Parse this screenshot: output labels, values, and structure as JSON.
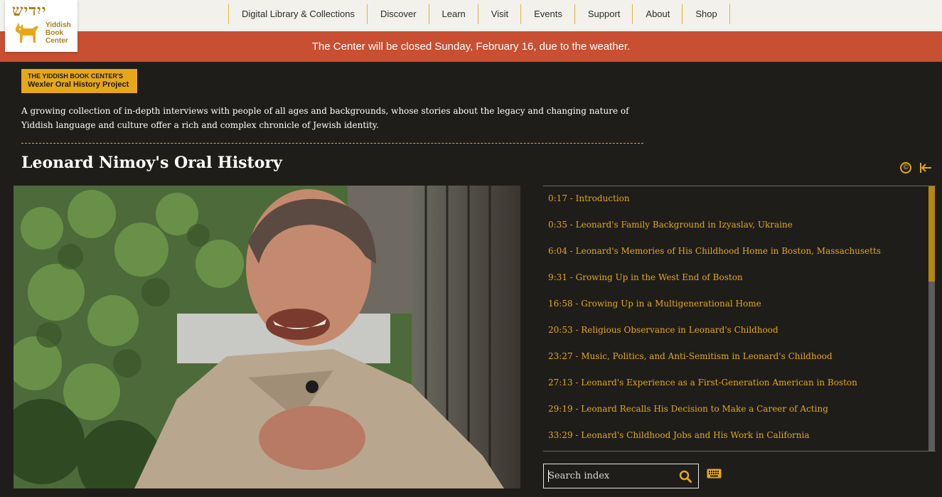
{
  "logo": {
    "hebrew": "ייִדיש",
    "name_line1": "Yiddish",
    "name_line2": "Book",
    "name_line3": "Center"
  },
  "nav": [
    "Digital Library & Collections",
    "Discover",
    "Learn",
    "Visit",
    "Events",
    "Support",
    "About",
    "Shop"
  ],
  "alert": "The Center will be closed Sunday, February 16, due to the weather.",
  "badge": {
    "line1": "THE YIDDISH BOOK CENTER'S",
    "line2": "Wexler Oral History Project"
  },
  "intro": "A growing collection of in-depth interviews with people of all ages and backgrounds, whose stories about the legacy and changing nature of Yiddish language and culture offer a rich and complex chronicle of Jewish identity.",
  "title": "Leonard Nimoy's Oral History",
  "icons": {
    "copyright": "©",
    "colors": {
      "accent": "#e0a81e",
      "alert": "#c94f32",
      "background": "#1f1d1a"
    }
  },
  "index": [
    "0:17 - Introduction",
    "0:35 - Leonard's Family Background in Izyaslav, Ukraine",
    "6:04 - Leonard's Memories of His Childhood Home in Boston, Massachusetts",
    "9:31 - Growing Up in the West End of Boston",
    "16:58 - Growing Up in a Multigenerational Home",
    "20:53 - Religious Observance in Leonard's Childhood",
    "23:27 - Music, Politics, and Anti-Semitism in Leonard's Childhood",
    "27:13 - Leonard's Experience as a First-Generation American in Boston",
    "29:19 - Leonard Recalls His Decision to Make a Career of Acting",
    "33:29 - Leonard's Childhood Jobs and His Work in California"
  ],
  "search": {
    "placeholder": "Search index"
  }
}
